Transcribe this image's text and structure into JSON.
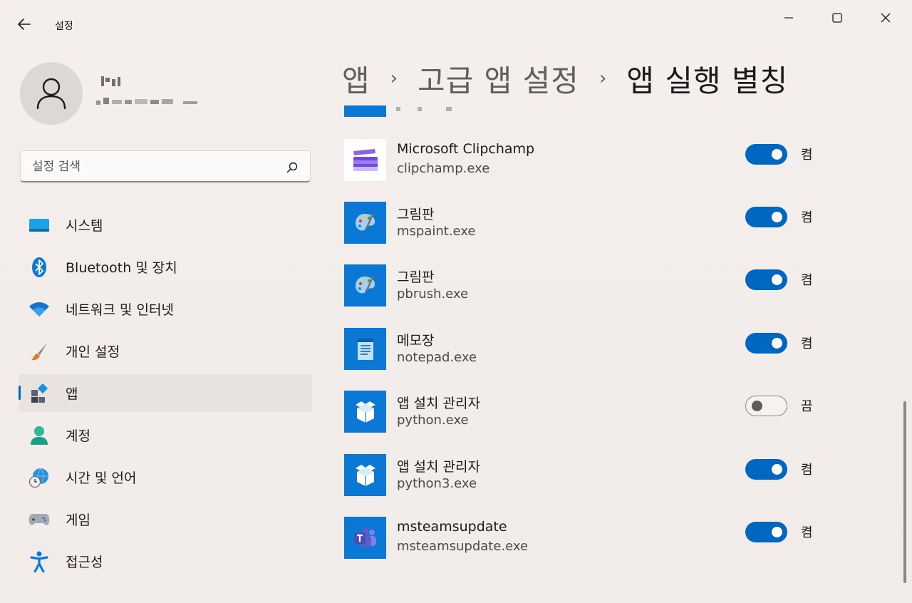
{
  "window": {
    "title": "설정",
    "minimize_icon": "minimize-icon",
    "maximize_icon": "maximize-icon",
    "close_icon": "close-icon"
  },
  "profile": {
    "avatar_icon": "person-icon"
  },
  "search": {
    "placeholder": "설정 검색",
    "value": ""
  },
  "sidebar": {
    "items": [
      {
        "label": "시스템",
        "icon": "system-display-icon",
        "active": false
      },
      {
        "label": "Bluetooth 및 장치",
        "icon": "bluetooth-icon",
        "active": false
      },
      {
        "label": "네트워크 및 인터넷",
        "icon": "wifi-icon",
        "active": false
      },
      {
        "label": "개인 설정",
        "icon": "paintbrush-icon",
        "active": false
      },
      {
        "label": "앱",
        "icon": "apps-icon",
        "active": true
      },
      {
        "label": "계정",
        "icon": "account-icon",
        "active": false
      },
      {
        "label": "시간 및 언어",
        "icon": "globe-clock-icon",
        "active": false
      },
      {
        "label": "게임",
        "icon": "gamepad-icon",
        "active": false
      },
      {
        "label": "접근성",
        "icon": "accessibility-icon",
        "active": false
      }
    ]
  },
  "breadcrumb": {
    "items": [
      "앱",
      "고급 앱 설정",
      "앱 실행 별칭"
    ],
    "separator": "›"
  },
  "aliases": [
    {
      "name": "Microsoft Clipchamp",
      "exe": "clipchamp.exe",
      "icon": "clipchamp-icon",
      "state": "켬",
      "on": true
    },
    {
      "name": "그림판",
      "exe": "mspaint.exe",
      "icon": "paint-palette-icon",
      "state": "켬",
      "on": true
    },
    {
      "name": "그림판",
      "exe": "pbrush.exe",
      "icon": "paint-palette-icon",
      "state": "켬",
      "on": true
    },
    {
      "name": "메모장",
      "exe": "notepad.exe",
      "icon": "notepad-icon",
      "state": "켬",
      "on": true
    },
    {
      "name": "앱 설치 관리자",
      "exe": "python.exe",
      "icon": "app-installer-icon",
      "state": "끔",
      "on": false
    },
    {
      "name": "앱 설치 관리자",
      "exe": "python3.exe",
      "icon": "app-installer-icon",
      "state": "켬",
      "on": true
    },
    {
      "name": "msteamsupdate",
      "exe": "msteamsupdate.exe",
      "icon": "teams-icon",
      "state": "켬",
      "on": true
    }
  ],
  "colors": {
    "accent": "#0067c0",
    "tile_blue": "#0a78d4"
  }
}
